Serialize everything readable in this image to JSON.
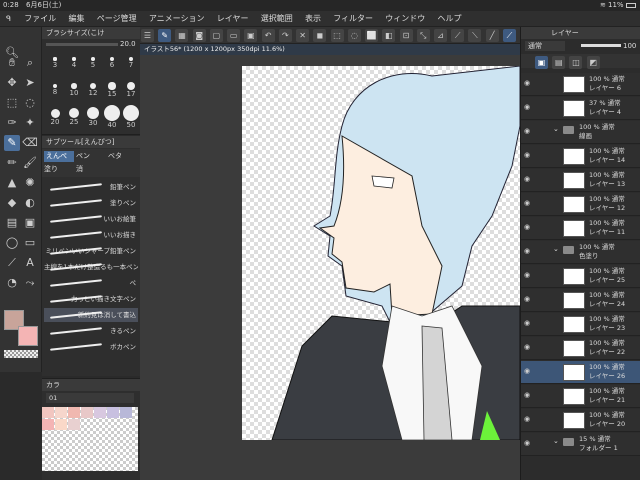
{
  "status": {
    "time": "0:28",
    "date": "6月6日(土)",
    "battery": "11%"
  },
  "menu": [
    "ファイル",
    "編集",
    "ページ管理",
    "アニメーション",
    "レイヤー",
    "選択範囲",
    "表示",
    "フィルター",
    "ウィンドウ",
    "ヘルプ"
  ],
  "brush_panel": {
    "title": "ブラシサイズ(こけ",
    "value": "20.0",
    "sizes": [
      "3",
      "4",
      "5",
      "6",
      "7",
      "8",
      "10",
      "12",
      "15",
      "17",
      "20",
      "25",
      "30",
      "40",
      "50"
    ]
  },
  "subtool_panel": {
    "title": "サブツール[えんぴつ]",
    "tabs": [
      "えんぺ",
      "ペン",
      "ベタ",
      "塗り",
      "消"
    ],
    "brushes": [
      "鉛筆ペン",
      "塗りペン",
      "いいお絵筆",
      "いいお描き",
      "ミリペンいいシャープ鉛筆ペン",
      "主線を1本だけ整造るも一本ペン",
      "ペ",
      "力っとい描き文字ペン",
      "新約見は消して書込",
      "きるペン",
      "ボカペン"
    ],
    "selected_index": 8
  },
  "colors": {
    "main": "#c8a49a",
    "sub": "#f4b4b4"
  },
  "palette": {
    "title": "カラ",
    "row_label": "01"
  },
  "document": {
    "tab": "イラスト56* (1200 x 1200px 350dpi 11.6%)"
  },
  "layer_panel": {
    "title": "レイヤー",
    "blend_mode": "通常",
    "opacity": "100",
    "layers": [
      {
        "line1": "100 % 通常",
        "line2": "レイヤー 6",
        "kind": "layer",
        "selected": false
      },
      {
        "line1": "37 % 通常",
        "line2": "レイヤー 4",
        "kind": "layer",
        "selected": false
      },
      {
        "line1": "100 % 通常",
        "line2": "線画",
        "kind": "folder",
        "selected": false
      },
      {
        "line1": "100 % 通常",
        "line2": "レイヤー 14",
        "kind": "layer",
        "selected": false
      },
      {
        "line1": "100 % 通常",
        "line2": "レイヤー 13",
        "kind": "layer",
        "selected": false
      },
      {
        "line1": "100 % 通常",
        "line2": "レイヤー 12",
        "kind": "layer",
        "selected": false
      },
      {
        "line1": "100 % 通常",
        "line2": "レイヤー 11",
        "kind": "layer",
        "selected": false
      },
      {
        "line1": "100 % 通常",
        "line2": "色塗り",
        "kind": "folder",
        "selected": false
      },
      {
        "line1": "100 % 通常",
        "line2": "レイヤー 25",
        "kind": "layer",
        "selected": false
      },
      {
        "line1": "100 % 通常",
        "line2": "レイヤー 24",
        "kind": "layer",
        "selected": false
      },
      {
        "line1": "100 % 通常",
        "line2": "レイヤー 23",
        "kind": "layer",
        "selected": false
      },
      {
        "line1": "100 % 通常",
        "line2": "レイヤー 22",
        "kind": "layer",
        "selected": false
      },
      {
        "line1": "100 % 通常",
        "line2": "レイヤー 26",
        "kind": "layer",
        "selected": true
      },
      {
        "line1": "100 % 通常",
        "line2": "レイヤー 21",
        "kind": "layer",
        "selected": false
      },
      {
        "line1": "100 % 通常",
        "line2": "レイヤー 20",
        "kind": "layer",
        "selected": false
      },
      {
        "line1": "15 % 通常",
        "line2": "フォルダー 1",
        "kind": "folder",
        "selected": false
      }
    ]
  }
}
